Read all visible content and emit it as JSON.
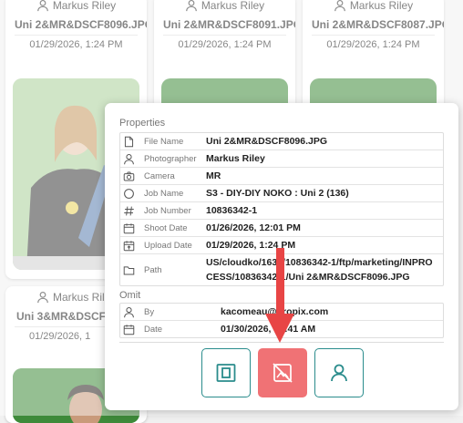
{
  "grid": {
    "cards": [
      {
        "photographer": "Markus Riley",
        "filename": "Uni 2&MR&DSCF8096.JPG",
        "date": "01/29/2026, 1:24 PM"
      },
      {
        "photographer": "Markus Riley",
        "filename": "Uni 2&MR&DSCF8091.JPG",
        "date": "01/29/2026, 1:24 PM"
      },
      {
        "photographer": "Markus Riley",
        "filename": "Uni 2&MR&DSCF8087.JPG",
        "date": "01/29/2026, 1:24 PM"
      },
      {
        "photographer": "Markus Rile",
        "filename": "Uni 3&MR&DSCF8",
        "date": "01/29/2026, 1"
      }
    ]
  },
  "panel": {
    "properties_title": "Properties",
    "properties": [
      {
        "icon": "file-icon",
        "label": "File Name",
        "value": "Uni 2&MR&DSCF8096.JPG"
      },
      {
        "icon": "person-icon",
        "label": "Photographer",
        "value": "Markus Riley"
      },
      {
        "icon": "camera-icon",
        "label": "Camera",
        "value": "MR"
      },
      {
        "icon": "circle-icon",
        "label": "Job Name",
        "value": "S3 - DIY-DIY NOKO : Uni 2 (136)"
      },
      {
        "icon": "hash-icon",
        "label": "Job Number",
        "value": "10836342-1"
      },
      {
        "icon": "calendar-icon",
        "label": "Shoot Date",
        "value": "01/26/2026, 12:01 PM"
      },
      {
        "icon": "calendar-upload-icon",
        "label": "Upload Date",
        "value": "01/29/2026, 1:24 PM"
      },
      {
        "icon": "folder-icon",
        "label": "Path",
        "value": "US/cloudko/1633/10836342-1/ftp/marketing/INPROCESS/10836342-1/Uni 2&MR&DSCF8096.JPG"
      }
    ],
    "omit_title": "Omit",
    "omit": [
      {
        "icon": "person-icon",
        "label": "By",
        "value": "kacomeau@dropix.com"
      },
      {
        "icon": "calendar-icon",
        "label": "Date",
        "value": "01/30/2026, 10:41 AM"
      }
    ],
    "buttons": [
      "crop-frame-icon",
      "image-off-icon",
      "person-icon"
    ]
  },
  "colors": {
    "accent": "#2a8c8c",
    "danger": "#f07275",
    "arrow": "#e84545"
  }
}
